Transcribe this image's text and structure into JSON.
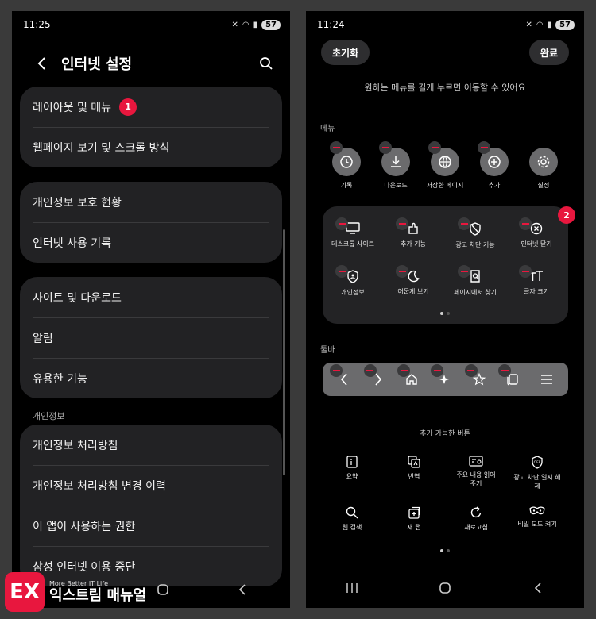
{
  "left": {
    "status": {
      "time": "11:25",
      "battery": "57"
    },
    "page_title": "인터넷 설정",
    "cards": [
      {
        "rows": [
          {
            "label": "레이아웃 및 메뉴",
            "badge": "1"
          },
          {
            "label": "웹페이지 보기 및 스크롤 방식"
          }
        ]
      },
      {
        "rows": [
          {
            "label": "개인정보 보호 현황"
          },
          {
            "label": "인터넷 사용 기록"
          }
        ]
      },
      {
        "rows": [
          {
            "label": "사이트 및 다운로드"
          },
          {
            "label": "알림"
          },
          {
            "label": "유용한 기능"
          }
        ]
      },
      {
        "rows": [
          {
            "label": "개인정보 처리방침"
          },
          {
            "label": "개인정보 처리방침 변경 이력"
          },
          {
            "label": "이 앱이 사용하는 권한"
          },
          {
            "label": "삼성 인터넷 이용 중단"
          }
        ]
      }
    ],
    "section_label": "개인정보"
  },
  "right": {
    "status": {
      "time": "11:24",
      "battery": "57"
    },
    "reset_label": "초기화",
    "done_label": "완료",
    "hint": "원하는 메뉴를 길게 누르면 이동할 수 있어요",
    "menu_label": "메뉴",
    "menu_items": [
      {
        "label": "기록",
        "icon": "clock-icon"
      },
      {
        "label": "다운로드",
        "icon": "download-icon"
      },
      {
        "label": "저장한 페이지",
        "icon": "saved-page-icon"
      },
      {
        "label": "추가",
        "icon": "plus-circle-icon"
      },
      {
        "label": "설정",
        "icon": "gear-icon"
      }
    ],
    "panel_badge": "2",
    "panel_items": [
      {
        "label": "데스크톱 사이트",
        "icon": "desktop-icon"
      },
      {
        "label": "추가 기능",
        "icon": "addon-icon"
      },
      {
        "label": "광고 차단 기능",
        "icon": "ad-block-icon"
      },
      {
        "label": "인터넷 닫기",
        "icon": "close-circle-icon"
      },
      {
        "label": "개인정보",
        "icon": "privacy-shield-icon"
      },
      {
        "label": "어둡게 보기",
        "icon": "moon-icon"
      },
      {
        "label": "페이지에서 찾기",
        "icon": "find-in-page-icon"
      },
      {
        "label": "글자 크기",
        "icon": "text-size-icon"
      }
    ],
    "toolbar_label": "툴바",
    "toolbar_items": [
      "back-icon",
      "forward-icon",
      "home-icon",
      "ai-sparkle-icon",
      "bookmark-star-icon",
      "tabs-icon",
      "hamburger-menu-icon"
    ],
    "available_title": "추가 가능한 버튼",
    "available_items": [
      {
        "label": "요약",
        "icon": "summary-icon"
      },
      {
        "label": "번역",
        "icon": "translate-icon"
      },
      {
        "label": "주요 내용 읽어주기",
        "icon": "read-aloud-icon"
      },
      {
        "label": "광고 차단 일시 해제",
        "icon": "ad-off-icon"
      },
      {
        "label": "웹 검색",
        "icon": "search-icon"
      },
      {
        "label": "새 탭",
        "icon": "new-tab-icon"
      },
      {
        "label": "새로고침",
        "icon": "refresh-icon"
      },
      {
        "label": "비밀 모드 켜기",
        "icon": "secret-mode-icon"
      }
    ]
  },
  "watermark": {
    "sub": "More Better IT Life",
    "main": "익스트림 매뉴얼",
    "logo": "EX"
  },
  "colors": {
    "accent": "#e8173e",
    "background": "#000000",
    "card": "#222224"
  }
}
